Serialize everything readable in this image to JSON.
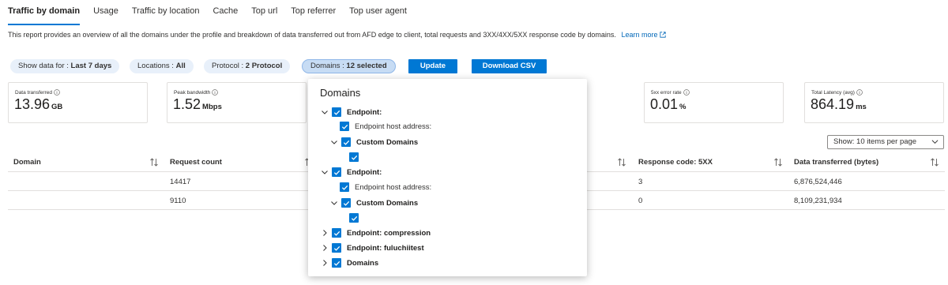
{
  "tabs": [
    "Traffic by domain",
    "Usage",
    "Traffic by location",
    "Cache",
    "Top url",
    "Top referrer",
    "Top user agent"
  ],
  "description": {
    "text": "This report provides an overview of all the domains under the profile and breakdown of data transferred out from AFD edge to client, total requests and 3XX/4XX/5XX response code by domains.",
    "link": "Learn more"
  },
  "filters": {
    "show_data": {
      "label": "Show data for :",
      "value": "Last 7 days"
    },
    "locations": {
      "label": "Locations :",
      "value": "All"
    },
    "protocol": {
      "label": "Protocol :",
      "value": "2 Protocol"
    },
    "domains": {
      "label": "Domains :",
      "value": "12 selected"
    }
  },
  "buttons": {
    "update": "Update",
    "download": "Download CSV"
  },
  "metrics": [
    {
      "label": "Data transferred",
      "value": "13.96",
      "unit": "GB"
    },
    {
      "label": "Peak bandwidth",
      "value": "1.52",
      "unit": "Mbps"
    },
    {
      "label": "5xx error rate",
      "value": "0.01",
      "unit": "%"
    },
    {
      "label": "Total Latency (avg)",
      "value": "864.19",
      "unit": "ms"
    }
  ],
  "page_size": "Show: 10 items per page",
  "table": {
    "columns": [
      "Domain",
      "Request count",
      "Response code: 5XX",
      "Data transferred (bytes)"
    ],
    "rows": [
      {
        "request_count": "14417",
        "response_5xx": "3",
        "data_transferred": "6,876,524,446"
      },
      {
        "request_count": "9110",
        "response_5xx": "0",
        "data_transferred": "8,109,231,934"
      }
    ]
  },
  "domains_dropdown": {
    "title": "Domains",
    "items": [
      {
        "label": "Endpoint:",
        "bold": true,
        "caret": "down"
      },
      {
        "label": "Endpoint host address:",
        "bold": false,
        "caret": ""
      },
      {
        "label": "Custom Domains",
        "bold": true,
        "caret": "down"
      },
      {
        "label": "",
        "bold": false,
        "caret": ""
      },
      {
        "label": "Endpoint:",
        "bold": true,
        "caret": "down"
      },
      {
        "label": "Endpoint host address:",
        "bold": false,
        "caret": ""
      },
      {
        "label": "Custom Domains",
        "bold": true,
        "caret": "down"
      },
      {
        "label": "",
        "bold": false,
        "caret": ""
      },
      {
        "label": "Endpoint: compression",
        "bold": true,
        "caret": "right"
      },
      {
        "label": "Endpoint: fuluchiitest",
        "bold": true,
        "caret": "right"
      },
      {
        "label": "Domains",
        "bold": true,
        "caret": "right"
      }
    ]
  },
  "colors": {
    "accent": "#0078d4",
    "pill": "#e8f0fa",
    "link": "#0067b8"
  }
}
